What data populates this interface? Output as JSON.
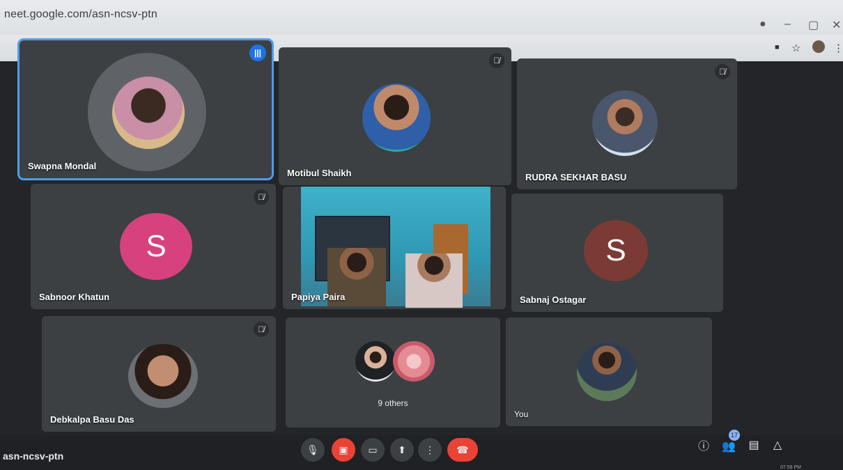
{
  "browser": {
    "url": "neet.google.com/asn-ncsv-ptn"
  },
  "participants": [
    {
      "name": "Swapna Mondal",
      "speaking": true
    },
    {
      "name": "Motibul Shaikh",
      "muted": true
    },
    {
      "name": "RUDRA SEKHAR BASU",
      "muted": true
    },
    {
      "name": "Sabnoor Khatun",
      "muted": true,
      "initial": "S",
      "color": "#d6417e"
    },
    {
      "name": "Papiya Paira"
    },
    {
      "name": "Sabnaj Ostagar",
      "initial": "S",
      "color": "#7b3b34"
    },
    {
      "name": "Debkalpa Basu Das",
      "muted": true
    },
    {
      "name": "9 others"
    },
    {
      "name": "You"
    }
  ],
  "meeting": {
    "code": "asn-ncsv-ptn",
    "participant_count": "17"
  },
  "taskbar": {
    "time": "07:58 PM"
  },
  "colors": {
    "accent": "#1a73e8",
    "tile": "#3c4043",
    "danger": "#ea4335"
  }
}
